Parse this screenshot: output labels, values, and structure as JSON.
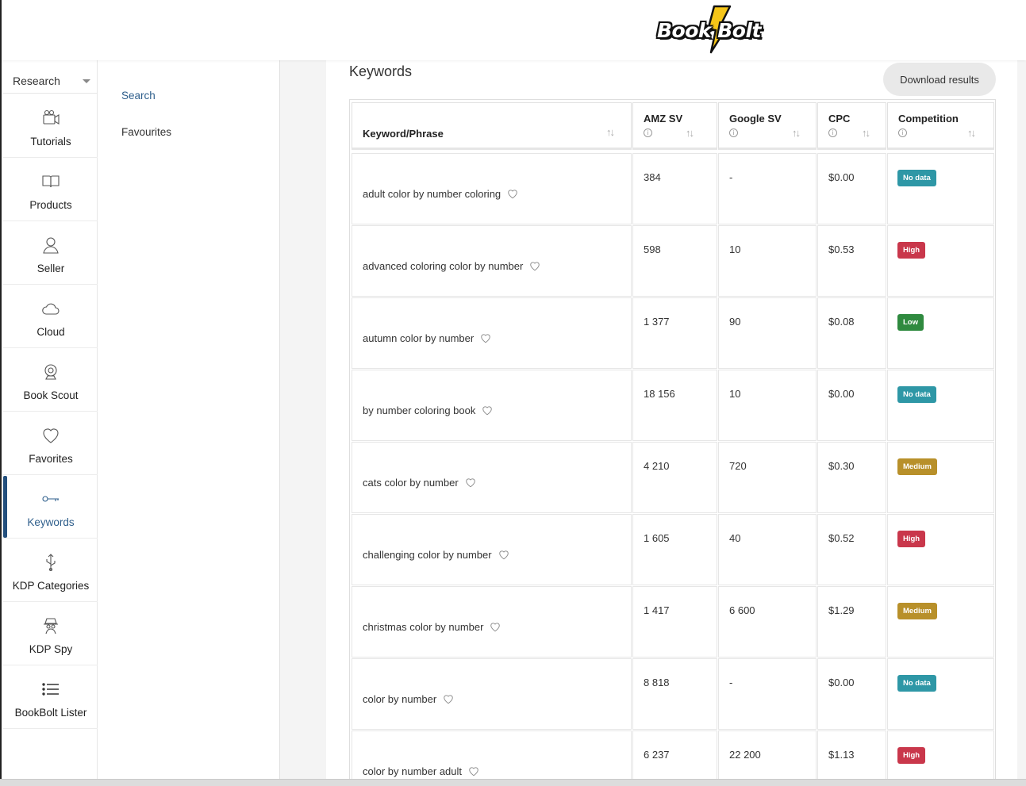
{
  "brand": {
    "logo_text": "Book Bolt"
  },
  "sidebar": {
    "dropdown_label": "Research",
    "items": [
      {
        "label": "Tutorials",
        "icon": "camera-icon"
      },
      {
        "label": "Products",
        "icon": "book-icon"
      },
      {
        "label": "Seller",
        "icon": "user-icon"
      },
      {
        "label": "Cloud",
        "icon": "cloud-icon"
      },
      {
        "label": "Book Scout",
        "icon": "webcam-icon"
      },
      {
        "label": "Favorites",
        "icon": "heart-icon"
      },
      {
        "label": "Keywords",
        "icon": "key-icon",
        "active": true
      },
      {
        "label": "KDP Categories",
        "icon": "usb-icon"
      },
      {
        "label": "KDP Spy",
        "icon": "spy-icon"
      },
      {
        "label": "BookBolt Lister",
        "icon": "list-icon"
      }
    ]
  },
  "subnav": {
    "items": [
      "Search",
      "Favourites"
    ]
  },
  "main": {
    "title": "Keywords",
    "download_label": "Download results",
    "columns": [
      "Keyword/Phrase",
      "AMZ SV",
      "Google SV",
      "CPC",
      "Competition"
    ],
    "rows": [
      {
        "keyword": "adult color by number coloring",
        "amz_sv": "384",
        "google_sv": "-",
        "cpc": "$0.00",
        "competition": "No data"
      },
      {
        "keyword": "advanced coloring color by number",
        "amz_sv": "598",
        "google_sv": "10",
        "cpc": "$0.53",
        "competition": "High"
      },
      {
        "keyword": "autumn color by number",
        "amz_sv": "1 377",
        "google_sv": "90",
        "cpc": "$0.08",
        "competition": "Low"
      },
      {
        "keyword": "by number coloring book",
        "amz_sv": "18 156",
        "google_sv": "10",
        "cpc": "$0.00",
        "competition": "No data"
      },
      {
        "keyword": "cats color by number",
        "amz_sv": "4 210",
        "google_sv": "720",
        "cpc": "$0.30",
        "competition": "Medium"
      },
      {
        "keyword": "challenging color by number",
        "amz_sv": "1 605",
        "google_sv": "40",
        "cpc": "$0.52",
        "competition": "High"
      },
      {
        "keyword": "christmas color by number",
        "amz_sv": "1 417",
        "google_sv": "6 600",
        "cpc": "$1.29",
        "competition": "Medium"
      },
      {
        "keyword": "color by number",
        "amz_sv": "8 818",
        "google_sv": "-",
        "cpc": "$0.00",
        "competition": "No data"
      },
      {
        "keyword": "color by number adult",
        "amz_sv": "6 237",
        "google_sv": "22 200",
        "cpc": "$1.13",
        "competition": "High"
      }
    ]
  },
  "colors": {
    "no_data": "#2e97a6",
    "high": "#c9374b",
    "low": "#2f8a3f",
    "medium": "#b8902a",
    "accent": "#2f5f8c"
  }
}
